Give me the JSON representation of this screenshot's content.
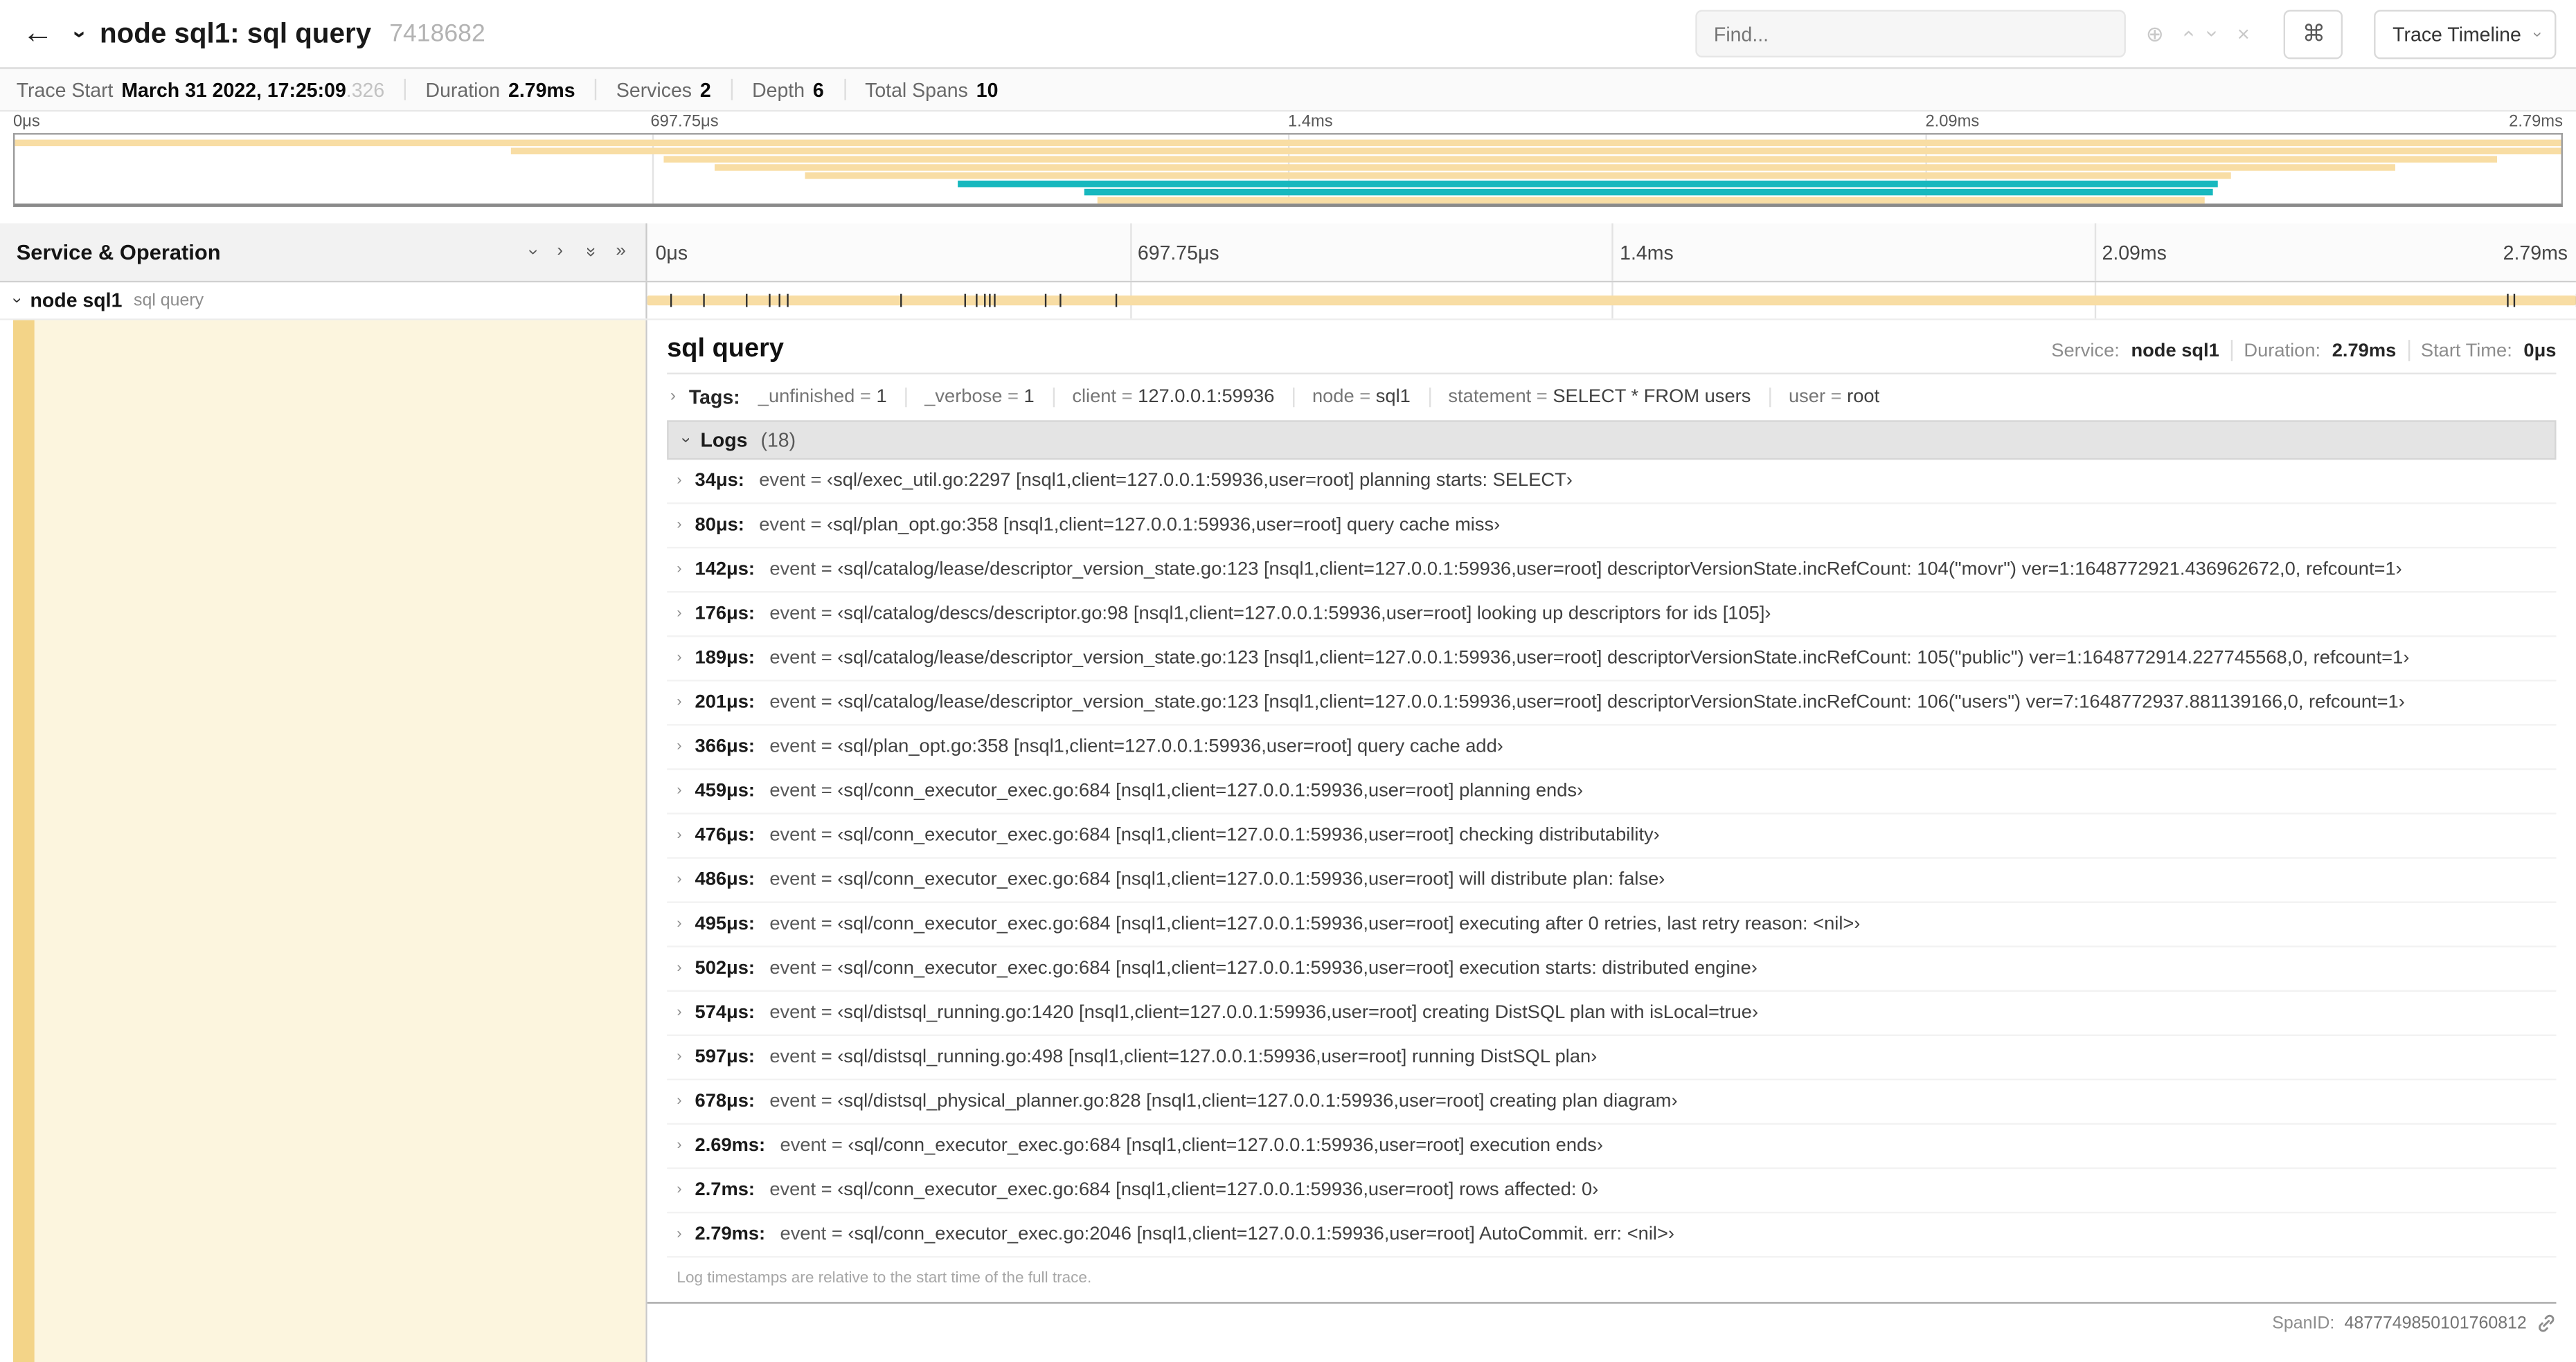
{
  "colors": {
    "tan": "#F8DDA4",
    "teal": "#17B8BE",
    "accent": "#F3D488",
    "left_bg": "#FCF5DE"
  },
  "header": {
    "icons": {
      "back": "←",
      "locate": "⊕",
      "clear": "×",
      "shortcut": "⌘"
    },
    "title": "node sql1: sql query",
    "trace_id": "7418682",
    "find_placeholder": "Find...",
    "view_button": "Trace Timeline"
  },
  "summary": {
    "trace_start_label": "Trace Start",
    "trace_start_value": "March 31 2022, 17:25:09",
    "trace_start_ms": ".326",
    "duration_label": "Duration",
    "duration_value": "2.79ms",
    "services_label": "Services",
    "services_value": "2",
    "depth_label": "Depth",
    "depth_value": "6",
    "total_spans_label": "Total Spans",
    "total_spans_value": "10"
  },
  "timeline": {
    "left_header": "Service & Operation",
    "total_us": 2790,
    "ticks": [
      {
        "label": "0μs",
        "pos": 0
      },
      {
        "label": "697.75μs",
        "pos": 25
      },
      {
        "label": "1.4ms",
        "pos": 50
      },
      {
        "label": "2.09ms",
        "pos": 75
      },
      {
        "label": "2.79ms",
        "pos": 100
      }
    ],
    "row": {
      "service": "node sql1",
      "operation": "sql query",
      "start_pct": 0,
      "width_pct": 100
    }
  },
  "minimap": {
    "spans": [
      {
        "row": 0,
        "start": 0,
        "end": 100,
        "color": "tan"
      },
      {
        "row": 1,
        "start": 19.5,
        "end": 100,
        "color": "tan"
      },
      {
        "row": 2,
        "start": 25.5,
        "end": 97.5,
        "color": "tan"
      },
      {
        "row": 3,
        "start": 27.5,
        "end": 93.5,
        "color": "tan"
      },
      {
        "row": 4,
        "start": 31,
        "end": 87,
        "color": "tan"
      },
      {
        "row": 5,
        "start": 37,
        "end": 86.5,
        "color": "teal"
      },
      {
        "row": 6,
        "start": 42,
        "end": 86.3,
        "color": "teal"
      },
      {
        "row": 7,
        "start": 42.5,
        "end": 86,
        "color": "tan"
      }
    ]
  },
  "detail": {
    "title": "sql query",
    "service_label": "Service:",
    "service": "node sql1",
    "duration_label": "Duration:",
    "duration": "2.79ms",
    "start_label": "Start Time:",
    "start": "0μs",
    "tags_label": "Tags:",
    "tags": [
      {
        "key": "_unfinished",
        "value": "1"
      },
      {
        "key": "_verbose",
        "value": "1"
      },
      {
        "key": "client",
        "value": "127.0.0.1:59936"
      },
      {
        "key": "node",
        "value": "sql1"
      },
      {
        "key": "statement",
        "value": "SELECT * FROM users"
      },
      {
        "key": "user",
        "value": "root"
      }
    ],
    "logs_label": "Logs",
    "logs_count": "(18)",
    "logs": [
      {
        "time": "34μs",
        "t_us": 34,
        "field": "event",
        "value": "‹sql/exec_util.go:2297 [nsql1,client=127.0.0.1:59936,user=root] planning starts: SELECT›"
      },
      {
        "time": "80μs",
        "t_us": 80,
        "field": "event",
        "value": "‹sql/plan_opt.go:358 [nsql1,client=127.0.0.1:59936,user=root] query cache miss›"
      },
      {
        "time": "142μs",
        "t_us": 142,
        "field": "event",
        "value": "‹sql/catalog/lease/descriptor_version_state.go:123 [nsql1,client=127.0.0.1:59936,user=root] descriptorVersionState.incRefCount: 104(\"movr\") ver=1:1648772921.436962672,0, refcount=1›"
      },
      {
        "time": "176μs",
        "t_us": 176,
        "field": "event",
        "value": "‹sql/catalog/descs/descriptor.go:98 [nsql1,client=127.0.0.1:59936,user=root] looking up descriptors for ids [105]›"
      },
      {
        "time": "189μs",
        "t_us": 189,
        "field": "event",
        "value": "‹sql/catalog/lease/descriptor_version_state.go:123 [nsql1,client=127.0.0.1:59936,user=root] descriptorVersionState.incRefCount: 105(\"public\") ver=1:1648772914.227745568,0, refcount=1›"
      },
      {
        "time": "201μs",
        "t_us": 201,
        "field": "event",
        "value": "‹sql/catalog/lease/descriptor_version_state.go:123 [nsql1,client=127.0.0.1:59936,user=root] descriptorVersionState.incRefCount: 106(\"users\") ver=7:1648772937.881139166,0, refcount=1›"
      },
      {
        "time": "366μs",
        "t_us": 366,
        "field": "event",
        "value": "‹sql/plan_opt.go:358 [nsql1,client=127.0.0.1:59936,user=root] query cache add›"
      },
      {
        "time": "459μs",
        "t_us": 459,
        "field": "event",
        "value": "‹sql/conn_executor_exec.go:684 [nsql1,client=127.0.0.1:59936,user=root] planning ends›"
      },
      {
        "time": "476μs",
        "t_us": 476,
        "field": "event",
        "value": "‹sql/conn_executor_exec.go:684 [nsql1,client=127.0.0.1:59936,user=root] checking distributability›"
      },
      {
        "time": "486μs",
        "t_us": 486,
        "field": "event",
        "value": "‹sql/conn_executor_exec.go:684 [nsql1,client=127.0.0.1:59936,user=root] will distribute plan: false›"
      },
      {
        "time": "495μs",
        "t_us": 495,
        "field": "event",
        "value": "‹sql/conn_executor_exec.go:684 [nsql1,client=127.0.0.1:59936,user=root] executing after 0 retries, last retry reason: <nil>›"
      },
      {
        "time": "502μs",
        "t_us": 502,
        "field": "event",
        "value": "‹sql/conn_executor_exec.go:684 [nsql1,client=127.0.0.1:59936,user=root] execution starts: distributed engine›"
      },
      {
        "time": "574μs",
        "t_us": 574,
        "field": "event",
        "value": "‹sql/distsql_running.go:1420 [nsql1,client=127.0.0.1:59936,user=root] creating DistSQL plan with isLocal=true›"
      },
      {
        "time": "597μs",
        "t_us": 597,
        "field": "event",
        "value": "‹sql/distsql_running.go:498 [nsql1,client=127.0.0.1:59936,user=root] running DistSQL plan›"
      },
      {
        "time": "678μs",
        "t_us": 678,
        "field": "event",
        "value": "‹sql/distsql_physical_planner.go:828 [nsql1,client=127.0.0.1:59936,user=root] creating plan diagram›"
      },
      {
        "time": "2.69ms",
        "t_us": 2690,
        "field": "event",
        "value": "‹sql/conn_executor_exec.go:684 [nsql1,client=127.0.0.1:59936,user=root] execution ends›"
      },
      {
        "time": "2.7ms",
        "t_us": 2700,
        "field": "event",
        "value": "‹sql/conn_executor_exec.go:684 [nsql1,client=127.0.0.1:59936,user=root] rows affected: 0›"
      },
      {
        "time": "2.79ms",
        "t_us": 2790,
        "field": "event",
        "value": "‹sql/conn_executor_exec.go:2046 [nsql1,client=127.0.0.1:59936,user=root] AutoCommit. err: <nil>›"
      }
    ],
    "footnote": "Log timestamps are relative to the start time of the full trace.",
    "span_id_label": "SpanID:",
    "span_id": "4877749850101760812"
  }
}
